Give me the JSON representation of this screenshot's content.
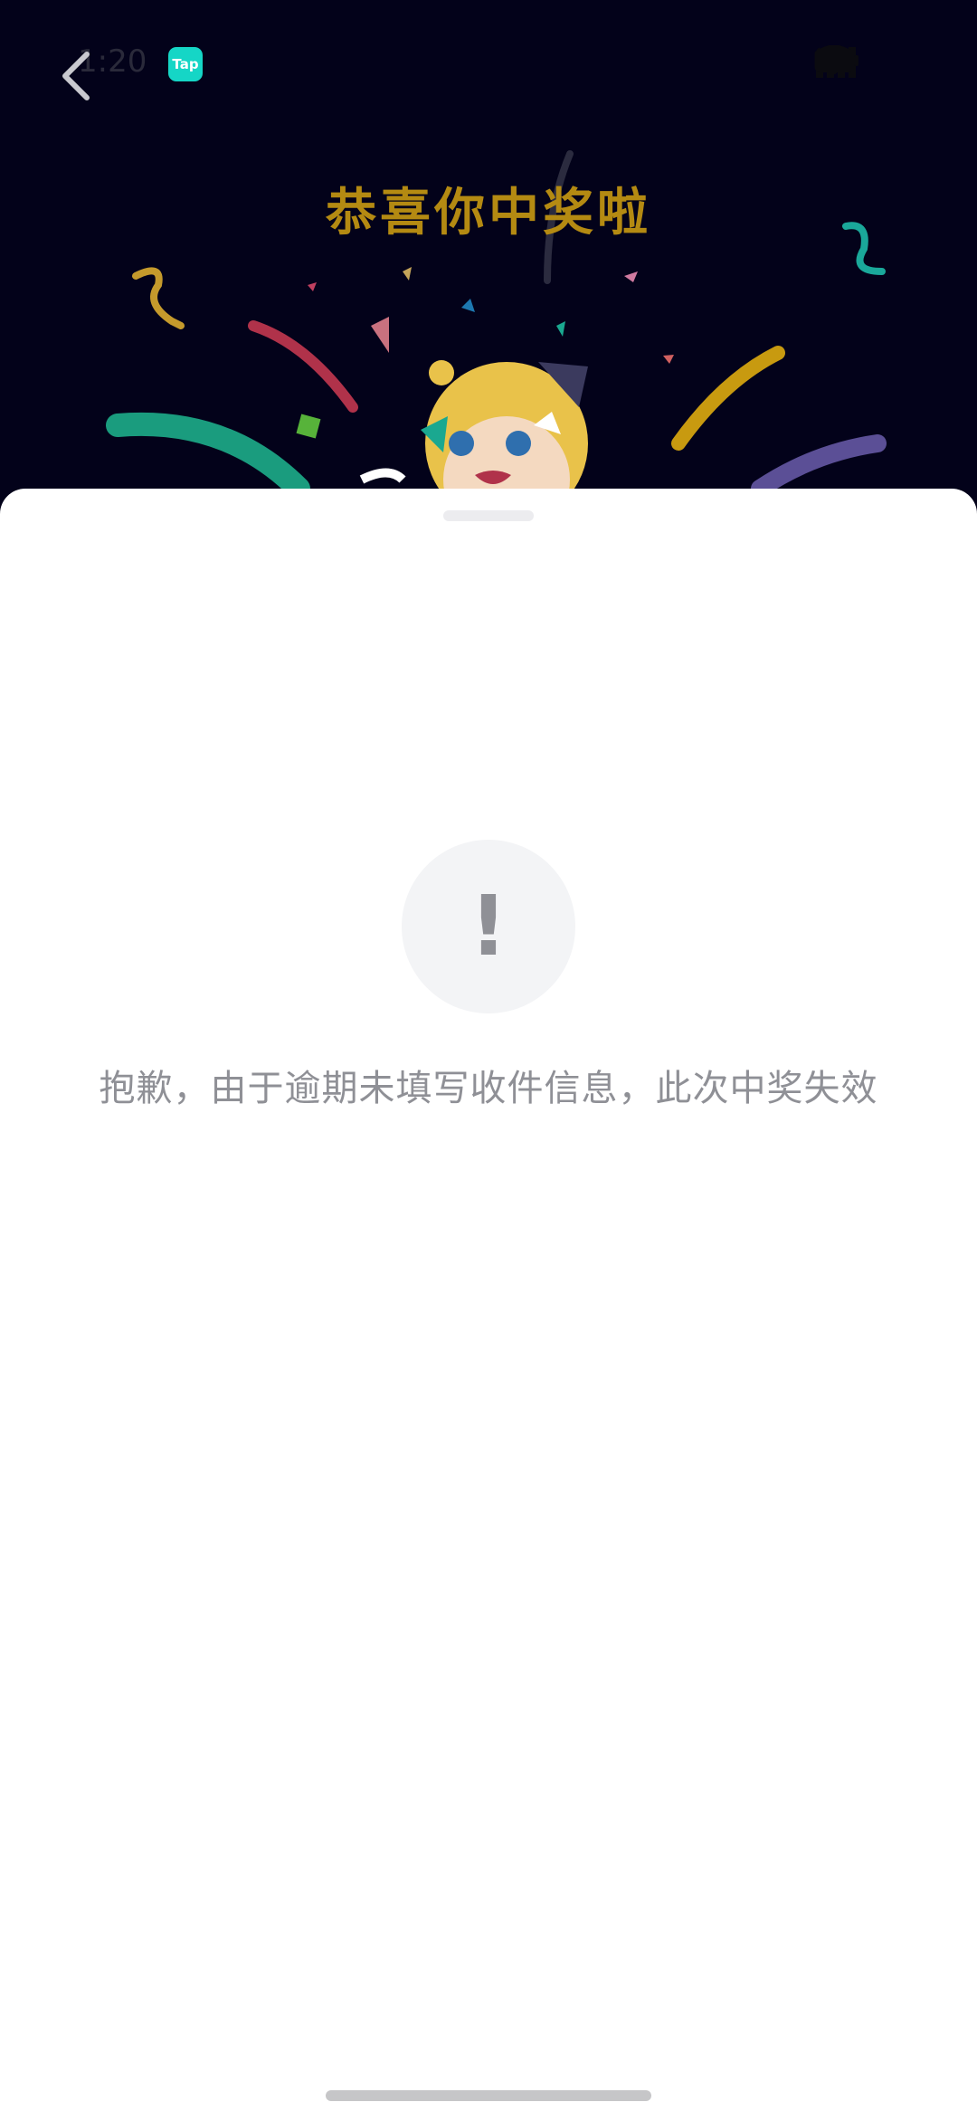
{
  "status_bar": {
    "time": "1:20",
    "app_badge": "Tap"
  },
  "header": {
    "celebrate_title": "恭喜你中奖啦"
  },
  "sheet": {
    "alert_symbol": "!",
    "message": "抱歉，由于逾期未填写收件信息，此次中奖失效"
  },
  "icons": {
    "back": "chevron-left-icon",
    "alert": "exclamation-icon",
    "mute": "mute-icon",
    "wifi": "wifi-icon",
    "signal": "signal-icon",
    "battery": "battery-icon"
  },
  "colors": {
    "backdrop": "#03021a",
    "title_gold": "#b48a12",
    "badge_teal": "#15d6c6",
    "message_gray": "#8f9096",
    "alert_circle": "#f3f4f6"
  }
}
